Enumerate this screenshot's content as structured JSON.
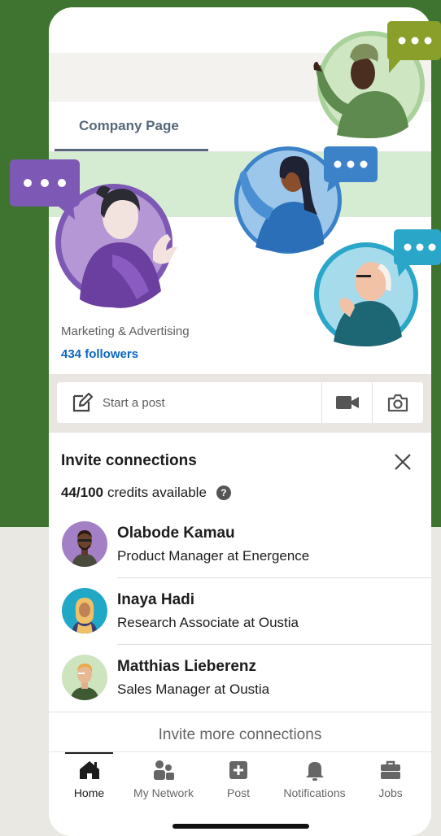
{
  "tabs": {
    "company_page": "Company Page"
  },
  "company": {
    "industry": "Marketing & Advertising",
    "followers": "434 followers"
  },
  "post_bar": {
    "start_post": "Start a post",
    "pencil_icon": "pencil-icon",
    "video_icon": "video-camera-icon",
    "camera_icon": "camera-icon"
  },
  "invite": {
    "title": "Invite connections",
    "credits_used": "44/100",
    "credits_text": "credits available",
    "help_glyph": "?",
    "connections": [
      {
        "name": "Olabode Kamau",
        "headline": "Product Manager at Energence"
      },
      {
        "name": "Inaya Hadi",
        "headline": "Research Associate at Oustia"
      },
      {
        "name": "Matthias Lieberenz",
        "headline": "Sales Manager at Oustia"
      }
    ],
    "more_label": "Invite more connections"
  },
  "nav": {
    "items": [
      {
        "label": "Home",
        "icon": "home-icon"
      },
      {
        "label": "My Network",
        "icon": "network-icon"
      },
      {
        "label": "Post",
        "icon": "plus-square-icon"
      },
      {
        "label": "Notifications",
        "icon": "bell-icon"
      },
      {
        "label": "Jobs",
        "icon": "briefcase-icon"
      }
    ]
  },
  "colors": {
    "background_green": "#3f7430",
    "link_blue": "#0a66c2",
    "tab_gray": "#56687a",
    "bubble_purple": "#7d58b5",
    "bubble_blue": "#3c82c9",
    "bubble_teal": "#2aa6c8",
    "bubble_olive": "#8a9e2a"
  }
}
